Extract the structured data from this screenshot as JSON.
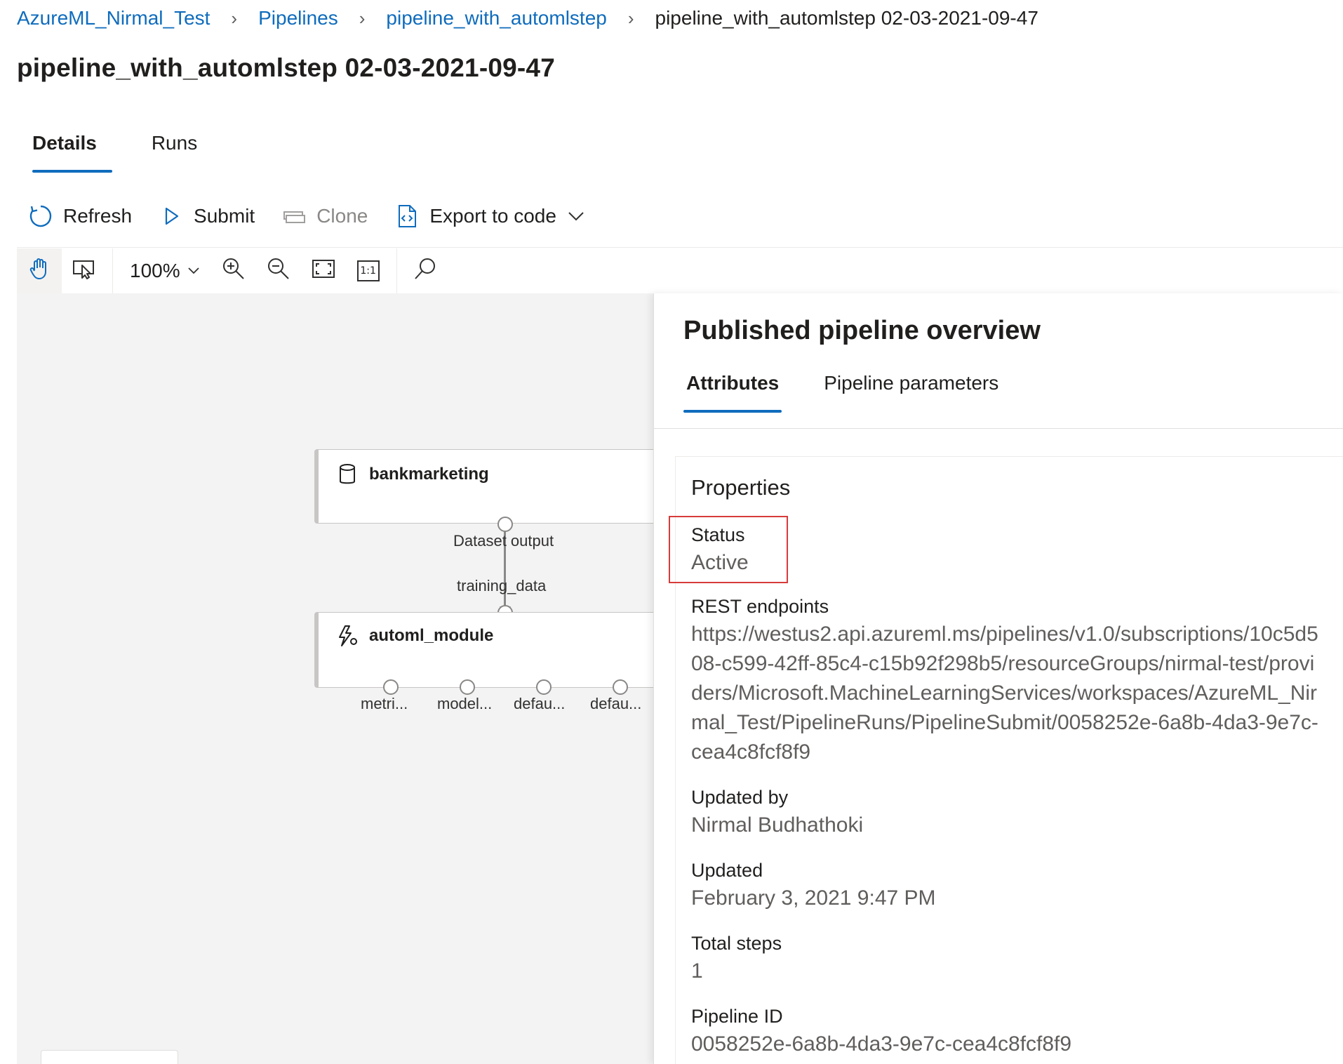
{
  "breadcrumb": {
    "items": [
      "AzureML_Nirmal_Test",
      "Pipelines",
      "pipeline_with_automlstep"
    ],
    "current": "pipeline_with_automlstep 02-03-2021-09-47"
  },
  "page_title": "pipeline_with_automlstep 02-03-2021-09-47",
  "tabs": [
    {
      "label": "Details",
      "active": true
    },
    {
      "label": "Runs",
      "active": false
    }
  ],
  "commands": {
    "refresh": "Refresh",
    "submit": "Submit",
    "clone": "Clone",
    "export": "Export to code"
  },
  "toolbar": {
    "zoom": "100%",
    "actual_size": "1:1"
  },
  "canvas": {
    "nodes": [
      {
        "title": "bankmarketing",
        "icon": "database-icon"
      },
      {
        "title": "automl_module",
        "icon": "automl-icon"
      }
    ],
    "edge": {
      "from_label": "Dataset output",
      "to_label": "training_data"
    },
    "output_ports": [
      "metri...",
      "model...",
      "defau...",
      "defau..."
    ]
  },
  "panel": {
    "title": "Published pipeline overview",
    "tabs": [
      {
        "label": "Attributes",
        "active": true
      },
      {
        "label": "Pipeline parameters",
        "active": false
      }
    ],
    "properties_heading": "Properties",
    "properties": {
      "status": {
        "label": "Status",
        "value": "Active"
      },
      "rest_endpoints": {
        "label": "REST endpoints",
        "value": "https://westus2.api.azureml.ms/pipelines/v1.0/subscriptions/10c5d508-c599-42ff-85c4-c15b92f298b5/resourceGroups/nirmal-test/providers/Microsoft.MachineLearningServices/workspaces/AzureML_Nirmal_Test/PipelineRuns/PipelineSubmit/0058252e-6a8b-4da3-9e7c-cea4c8fcf8f9"
      },
      "updated_by": {
        "label": "Updated by",
        "value": "Nirmal Budhathoki"
      },
      "updated": {
        "label": "Updated",
        "value": "February 3, 2021 9:47 PM"
      },
      "total_steps": {
        "label": "Total steps",
        "value": "1"
      },
      "pipeline_id": {
        "label": "Pipeline ID",
        "value": "0058252e-6a8b-4da3-9e7c-cea4c8fcf8f9"
      }
    }
  },
  "colors": {
    "accent": "#0f6cbd",
    "highlight": "#d83b3b",
    "canvas_bg": "#f3f3f3"
  }
}
